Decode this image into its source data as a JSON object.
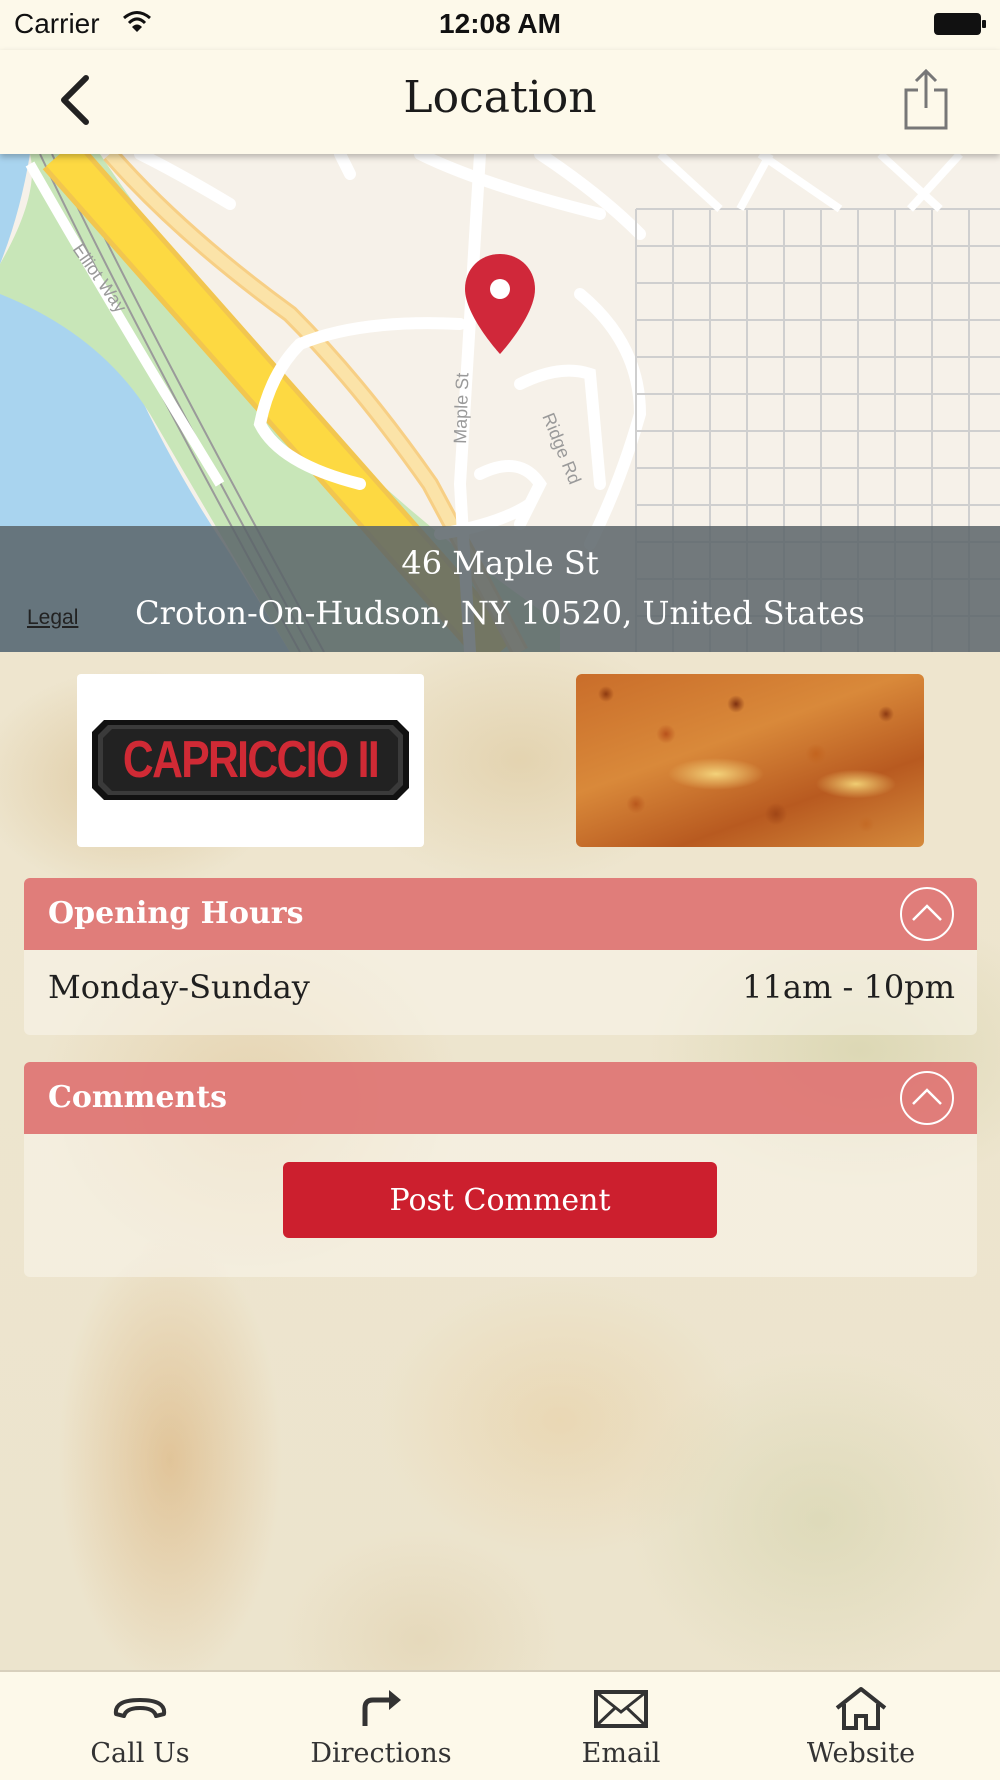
{
  "status_bar": {
    "carrier": "Carrier",
    "time": "12:08 AM"
  },
  "navbar": {
    "title": "Location",
    "back_icon": "chevron-left-icon",
    "share_icon": "share-icon"
  },
  "map": {
    "street_labels": [
      "Elliot Way",
      "Maple St",
      "Ridge Rd"
    ],
    "legal": "Legal",
    "address_line1": "46 Maple St",
    "address_line2": "Croton-On-Hudson, NY 10520, United States",
    "pin_color": "#d0283a"
  },
  "logo": {
    "text": "CAPRICCIO II"
  },
  "opening_hours": {
    "title": "Opening Hours",
    "rows": [
      {
        "day": "Monday-Sunday",
        "time": "11am - 10pm"
      }
    ]
  },
  "comments": {
    "title": "Comments",
    "post_label": "Post Comment"
  },
  "tabbar": {
    "items": [
      {
        "label": "Call Us",
        "icon": "phone-icon"
      },
      {
        "label": "Directions",
        "icon": "directions-icon"
      },
      {
        "label": "Email",
        "icon": "email-icon"
      },
      {
        "label": "Website",
        "icon": "home-icon"
      }
    ]
  },
  "colors": {
    "accent": "#cc1f2e",
    "panel_header": "#dc6464",
    "bar_bg": "#fdf9ea"
  }
}
